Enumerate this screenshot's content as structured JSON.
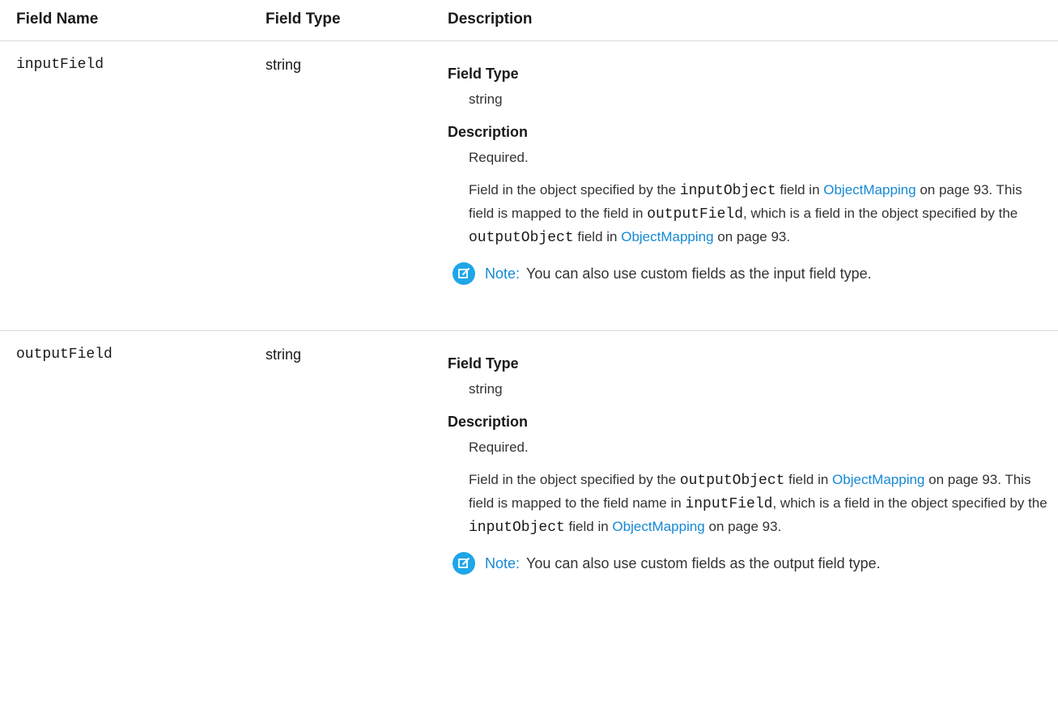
{
  "table": {
    "headers": {
      "field_name": "Field Name",
      "field_type": "Field Type",
      "description": "Description"
    },
    "rows": [
      {
        "name": "inputField",
        "type": "string",
        "desc_field_type_label": "Field Type",
        "desc_field_type_value": "string",
        "desc_description_label": "Description",
        "desc_required": "Required.",
        "body": {
          "t1": "Field in the object specified by the ",
          "c1": "inputObject",
          "t2": " field in ",
          "l1": "ObjectMapping",
          "t3": " on page 93. This field is mapped to the field in ",
          "c2": "outputField",
          "t4": ", which is a field in the object specified by the ",
          "c3": "outputObject",
          "t5": " field in ",
          "l2": "ObjectMapping",
          "t6": " on page 93."
        },
        "note_label": "Note:",
        "note_text": "You can also use custom fields as the input field type."
      },
      {
        "name": "outputField",
        "type": "string",
        "desc_field_type_label": "Field Type",
        "desc_field_type_value": "string",
        "desc_description_label": "Description",
        "desc_required": "Required.",
        "body": {
          "t1": "Field in the object specified by the ",
          "c1": "outputObject",
          "t2": " field in ",
          "l1": "ObjectMapping",
          "t3": " on page 93. This field is mapped to the field name in ",
          "c2": "inputField",
          "t4": ", which is a field in the object specified by the ",
          "c3": "inputObject",
          "t5": " field in ",
          "l2": "ObjectMapping",
          "t6": " on page 93."
        },
        "note_label": "Note:",
        "note_text": "You can also use custom fields as the output field type."
      }
    ]
  },
  "colors": {
    "link": "#1589d6",
    "note_icon": "#1fa6e8",
    "divider": "#d9d9d9"
  },
  "icons": {
    "note": "edit-note-icon"
  }
}
